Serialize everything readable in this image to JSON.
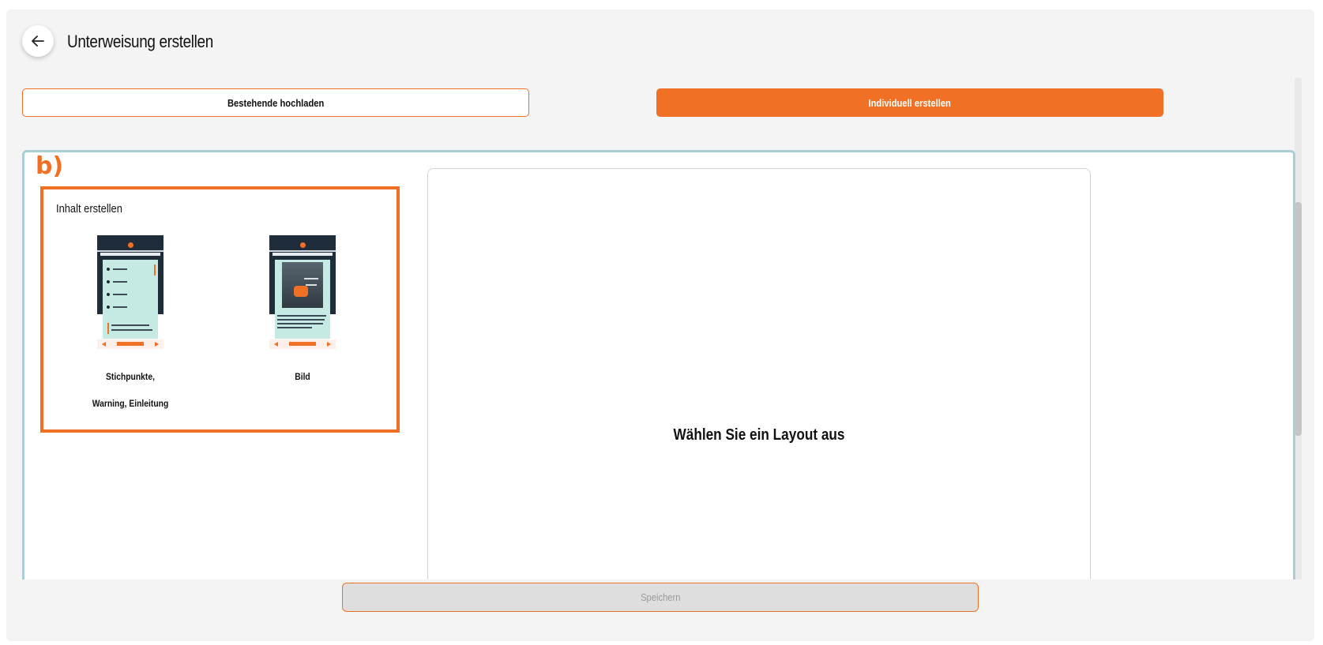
{
  "header": {
    "title": "Unterweisung erstellen",
    "back_icon": "arrow-left-icon"
  },
  "mode_buttons": {
    "upload_label": "Bestehende hochladen",
    "create_label": "Individuell erstellen",
    "active": "create"
  },
  "annotation": {
    "label": "b)"
  },
  "content_panel": {
    "title": "Inhalt erstellen",
    "layouts": [
      {
        "caption": "Stichpunkte, Warning, Einleitung",
        "thumb_type": "bullet-list-layout"
      },
      {
        "caption": "Bild",
        "thumb_type": "image-layout"
      }
    ]
  },
  "preview": {
    "message": "Wählen Sie ein Layout aus"
  },
  "footer": {
    "save_label": "Speichern",
    "save_enabled": false
  },
  "colors": {
    "accent": "#f07126",
    "workspace_border": "#a9cfd4",
    "thumb_dark": "#1f2d3a",
    "thumb_body": "#c5eae3"
  }
}
